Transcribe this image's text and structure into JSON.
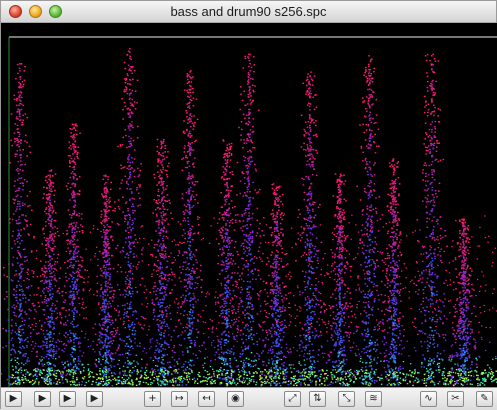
{
  "window": {
    "title": "bass and drum90 s256.spc"
  },
  "spectrogram": {
    "background": "#000000",
    "palette": [
      "#ff1a6a",
      "#d21c8c",
      "#7a2ae0",
      "#3a52f0",
      "#2a9cf0",
      "#38f0b8",
      "#b8ff3a"
    ]
  },
  "toolbar": {
    "buttons": [
      {
        "name": "play-button",
        "glyph": "▶"
      },
      {
        "name": "play-selection-button",
        "glyph": "▶"
      },
      {
        "name": "play-loop-button",
        "glyph": "▶"
      },
      {
        "name": "play-from-cursor-button",
        "glyph": "▶"
      },
      {
        "name": "zoom-in-time-button",
        "glyph": "+"
      },
      {
        "name": "expand-time-button",
        "glyph": "↦"
      },
      {
        "name": "shrink-time-button",
        "glyph": "↤"
      },
      {
        "name": "view-button",
        "glyph": "◉"
      },
      {
        "name": "fit-all-button",
        "glyph": "⤢"
      },
      {
        "name": "zoom-frequency-button",
        "glyph": "⇅"
      },
      {
        "name": "zoom-out-button",
        "glyph": "⤡"
      },
      {
        "name": "filter-button",
        "glyph": "≋"
      },
      {
        "name": "waveform-button",
        "glyph": "∿"
      },
      {
        "name": "cut-button",
        "glyph": "✂"
      },
      {
        "name": "pencil-button",
        "glyph": "✎"
      }
    ]
  }
}
